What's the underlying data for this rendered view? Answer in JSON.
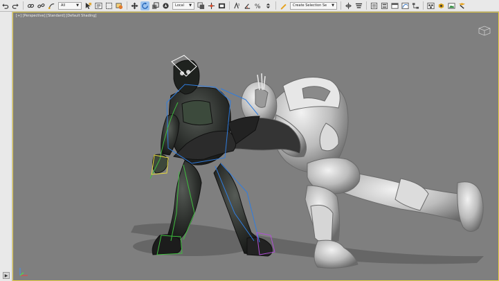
{
  "toolbar": {
    "filter_dropdown": "All",
    "coord_dropdown": "Local",
    "selection_set": "Create Selection Se"
  },
  "viewport": {
    "label": "[+] [Perspective] [Standard] [Default Shading]",
    "background": "#7f7f7f",
    "active_border": "#e9cf43"
  },
  "icons": {
    "undo": "undo-icon",
    "redo": "redo-icon",
    "link": "link-icon",
    "unlink": "unlink-icon",
    "bind": "bind-spacewarp-icon",
    "select": "select-object-icon",
    "select_name": "select-by-name-icon",
    "region": "rectangular-selection-icon",
    "window": "window-crossing-icon",
    "move": "move-icon",
    "rotate": "rotate-icon",
    "scale": "scale-icon",
    "place": "place-icon"
  }
}
